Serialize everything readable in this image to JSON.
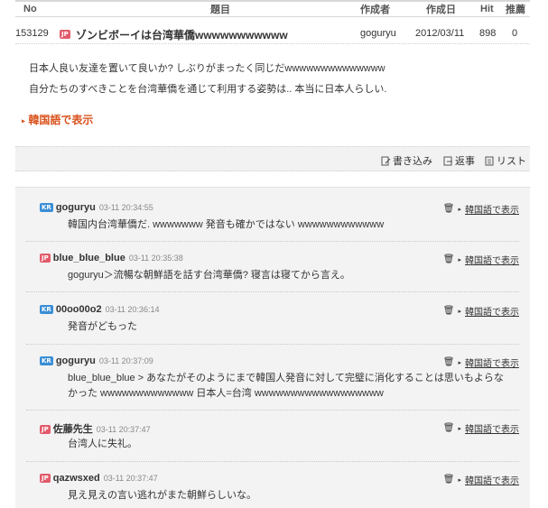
{
  "header": {
    "no": "No",
    "title": "題目",
    "author": "作成者",
    "date": "作成日",
    "hit": "Hit",
    "recommend": "推薦"
  },
  "post": {
    "no": "153129",
    "flag": "JP",
    "title": "ゾンビボーイは台湾華僑wwwwwwwwwww",
    "author": "goguryu",
    "date": "2012/03/11",
    "hit": "898",
    "recommend": "0"
  },
  "body": {
    "line1": "日本人良い友達を置いて良いか? しぶりがまったく同じだwwwwwwwwwwwwww",
    "line2": "自分たちのすべきことを台湾華僑を通じて利用する姿勢は.. 本当に日本人らしい.",
    "korean_link": "韓国語で表示"
  },
  "toolbar": {
    "write": "書き込み",
    "reply": "返事",
    "list": "リスト"
  },
  "comments": [
    {
      "flag": "KR",
      "author": "goguryu",
      "time": "03-11 20:34:55",
      "lines": [
        "韓国内台湾華僑だ. wwwwwww 発音も確かではない wwwwwwwwwwww"
      ],
      "link": "韓国語で表示"
    },
    {
      "flag": "JP",
      "author": "blue_blue_blue",
      "time": "03-11 20:35:38",
      "lines": [
        "goguryu＞流暢な朝鮮語を話す台湾華僑? 寝言は寝てから言え。"
      ],
      "link": "韓国語で表示"
    },
    {
      "flag": "KR",
      "author": "00oo00o2",
      "time": "03-11 20:36:14",
      "lines": [
        "発音がどもった"
      ],
      "link": "韓国語で表示"
    },
    {
      "flag": "KR",
      "author": "goguryu",
      "time": "03-11 20:37:09",
      "lines": [
        "blue_blue_blue > あなたがそのようにまで韓国人発音に対して完璧に消化することは思いもよらな",
        "かった wwwwwwwwwwwww 日本人=台湾 wwwwwwwwwwwwwwwwww"
      ],
      "link": "韓国語で表示"
    },
    {
      "flag": "JP",
      "author": "佐藤先生",
      "time": "03-11 20:37:47",
      "lines": [
        "台湾人に失礼。"
      ],
      "link": "韓国語で表示"
    },
    {
      "flag": "JP",
      "author": "qazwsxed",
      "time": "03-11 20:37:47",
      "lines": [
        "見え見えの言い逃れがまた朝鮮らしいな。"
      ],
      "link": "韓国語で表示"
    }
  ]
}
